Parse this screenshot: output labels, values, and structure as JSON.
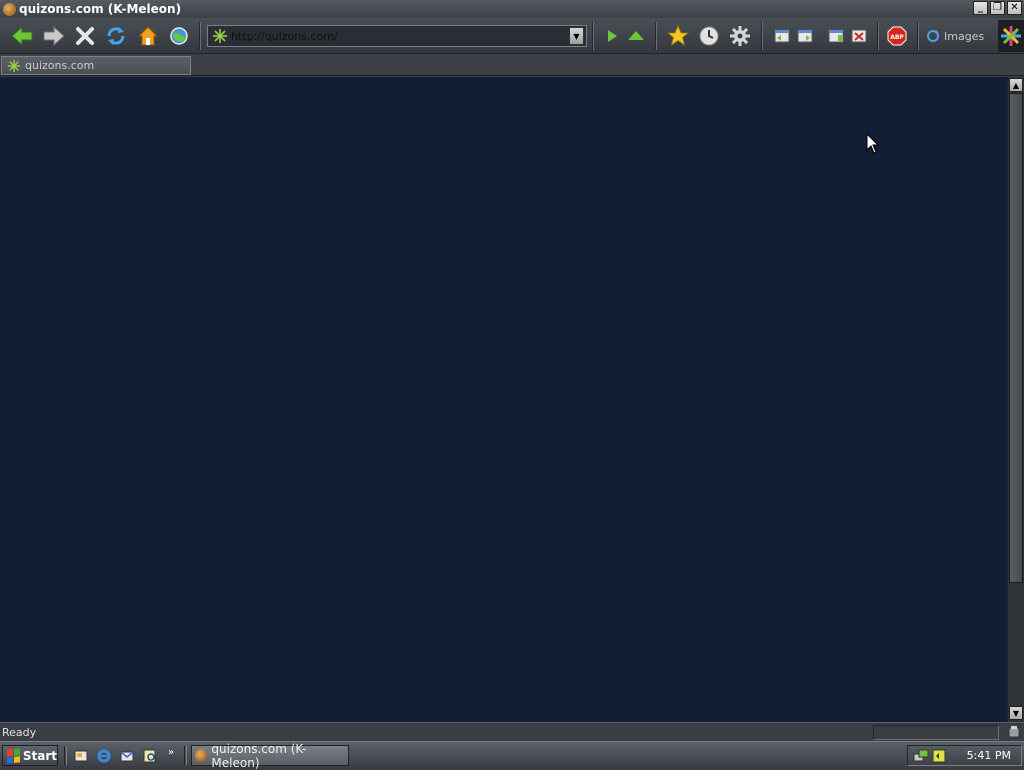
{
  "window": {
    "title": "quizons.com (K-Meleon)",
    "controls": [
      "minimize",
      "restore",
      "close"
    ]
  },
  "toolbar": {
    "buttons": [
      {
        "name": "back",
        "icon": "back-arrow-icon"
      },
      {
        "name": "forward",
        "icon": "forward-arrow-icon"
      },
      {
        "name": "stop",
        "icon": "stop-icon"
      },
      {
        "name": "reload",
        "icon": "reload-icon"
      },
      {
        "name": "home",
        "icon": "home-icon"
      },
      {
        "name": "search",
        "icon": "globe-icon"
      },
      {
        "name": "go",
        "icon": "go-icon"
      },
      {
        "name": "up",
        "icon": "up-icon"
      },
      {
        "name": "bookmarks",
        "icon": "star-icon"
      },
      {
        "name": "history",
        "icon": "history-clock-icon"
      },
      {
        "name": "preferences",
        "icon": "gear-icon"
      },
      {
        "name": "layout-1",
        "icon": "window-back-icon"
      },
      {
        "name": "layout-2",
        "icon": "window-forward-icon"
      },
      {
        "name": "new-window",
        "icon": "new-window-icon"
      },
      {
        "name": "close-window",
        "icon": "close-window-icon"
      },
      {
        "name": "adblock",
        "icon": "abp-icon"
      }
    ],
    "url": "http://quizons.com/",
    "images_label": "Images",
    "adblock_label": "ABP"
  },
  "tabs": [
    {
      "label": "quizons.com",
      "active": true
    }
  ],
  "status": {
    "text": "Ready"
  },
  "taskbar": {
    "start_label": "Start",
    "more_label": "»",
    "task_label": "quizons.com (K-Meleon)",
    "clock": "5:41 PM"
  },
  "colors": {
    "page_background": "#121d36",
    "chrome": "#3a3e44"
  }
}
